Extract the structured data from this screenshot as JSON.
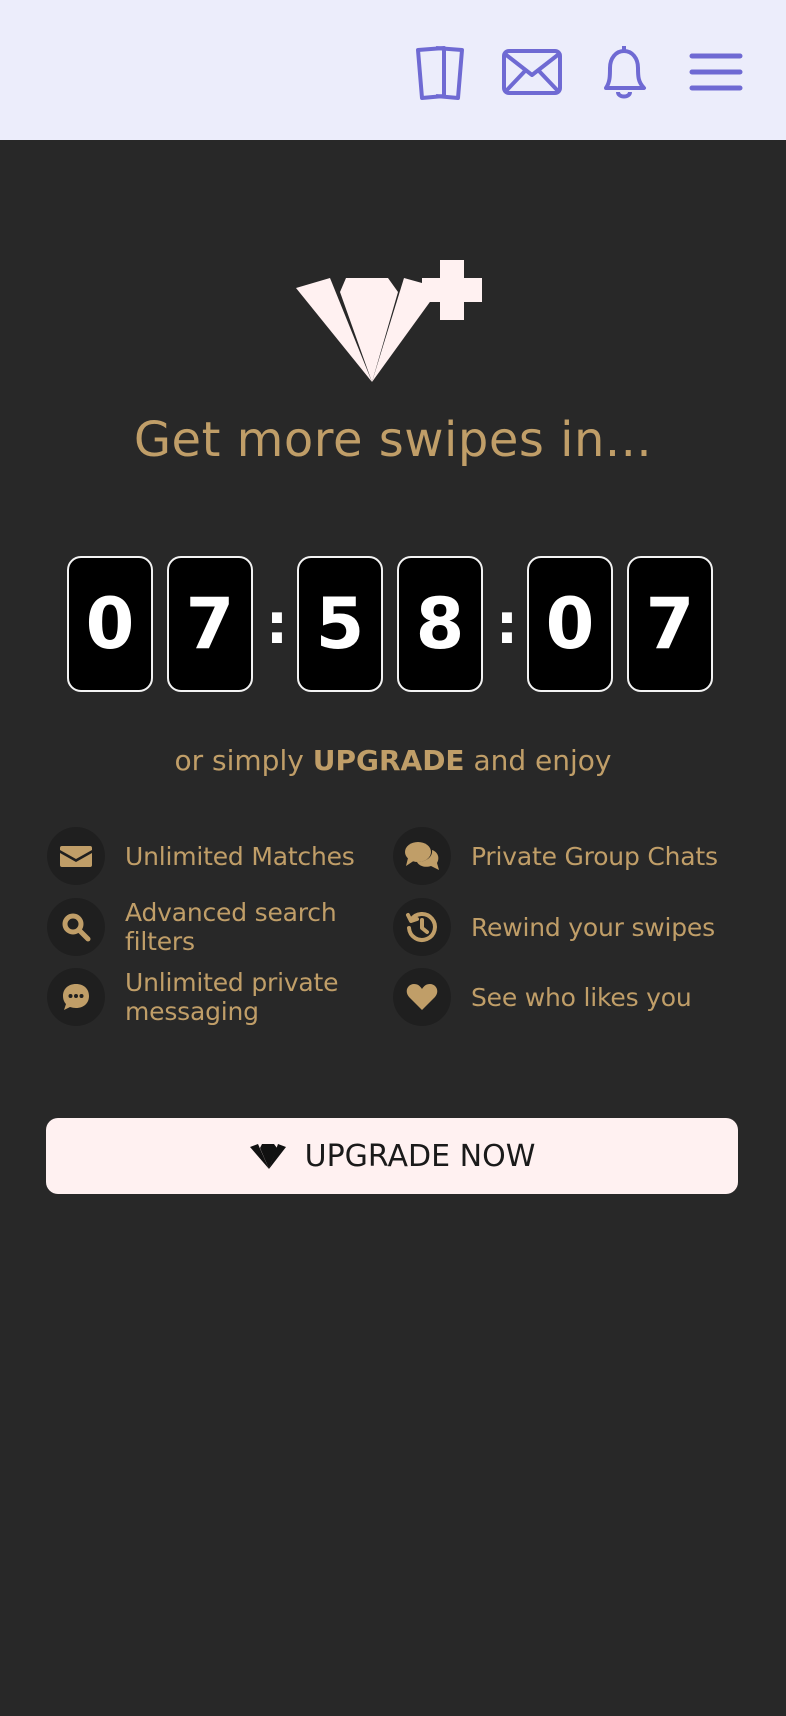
{
  "header": {
    "icons": [
      "cards-icon",
      "mail-icon",
      "bell-icon",
      "menu-icon"
    ],
    "accent": "#6f6ad3"
  },
  "hero": {
    "headline": "Get more swipes in...",
    "accent": "#c09e68"
  },
  "countdown": {
    "hours": [
      "0",
      "7"
    ],
    "minutes": [
      "5",
      "8"
    ],
    "seconds": [
      "0",
      "7"
    ],
    "separator": ":"
  },
  "upsell": {
    "prefix": "or simply",
    "emphasis": "UPGRADE",
    "suffix": "and enjoy"
  },
  "features": [
    {
      "icon": "envelope-icon",
      "label": "Unlimited Matches"
    },
    {
      "icon": "chat-bubbles-icon",
      "label": "Private Group Chats"
    },
    {
      "icon": "search-icon",
      "label": "Advanced search filters"
    },
    {
      "icon": "history-icon",
      "label": "Rewind your swipes"
    },
    {
      "icon": "message-icon",
      "label": "Unlimited private messaging"
    },
    {
      "icon": "heart-icon",
      "label": "See who likes you"
    }
  ],
  "cta": {
    "label": "UPGRADE NOW"
  }
}
